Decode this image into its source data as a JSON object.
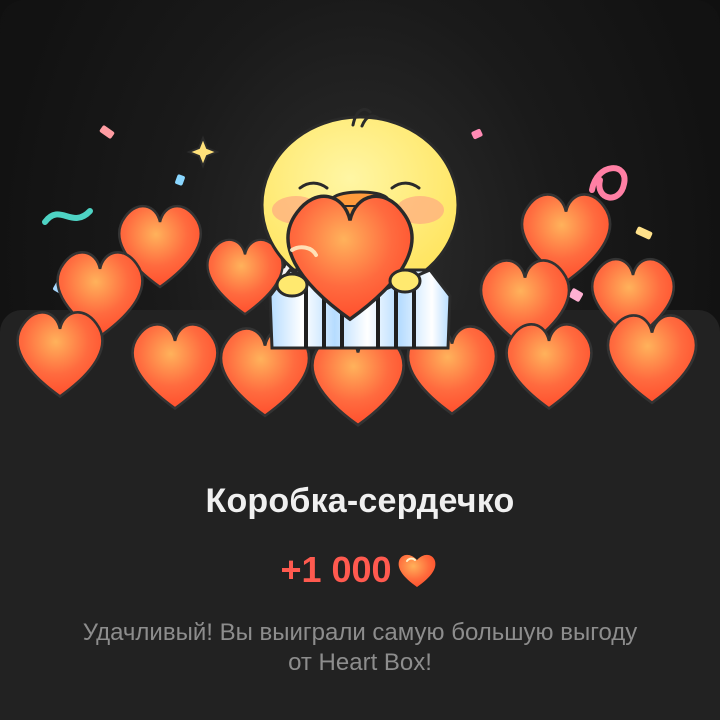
{
  "reward_dialog": {
    "title": "Коробка-сердечко",
    "amount": "+1 000",
    "currency_icon": "heart-icon",
    "description_line1": "Удачливый! Вы выиграли самую большую выгоду",
    "description_line2": "от Heart Box!"
  },
  "colors": {
    "background": "#101010",
    "sheet": "#222222",
    "accent": "#ff5a4f",
    "title": "#f0f0f0",
    "description": "#8d8d8d",
    "heart": "#ff6f43"
  },
  "illustration": {
    "character": "duck-character-icon",
    "gift_box": "gift-box-icon",
    "confetti": "confetti-icon"
  }
}
